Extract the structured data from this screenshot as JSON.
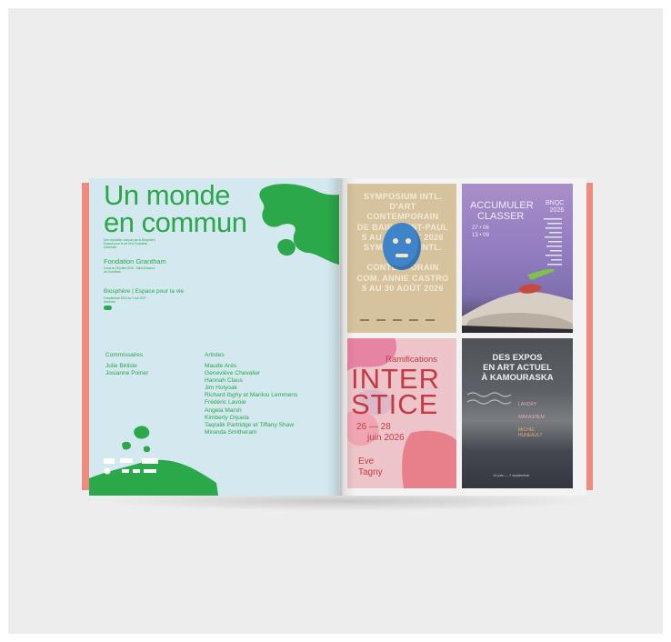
{
  "colors": {
    "background": "#ededed",
    "left_page": "#d3e8ef",
    "green_accent": "#2aa84a",
    "cover_edge": "#f08a7e",
    "poster1_bg": "#d6c39e",
    "poster3_bg": "#ecc4c9",
    "poster3_text": "#c43a43",
    "mask_blue": "#3f83c9"
  },
  "left_page": {
    "title_line1": "Un monde",
    "title_line2": "en commun",
    "intro": "Une exposition conçue par la Biosphère, Espace pour la vie et la Fondation Grantham",
    "venue1_name": "Fondation Grantham",
    "venue1_detail": "3 mai au 26 juillet 2026 · Saint-Edmond-de-Grantham",
    "venue2_name": "Biosphère | Espace pour la vie",
    "venue2_detail": "9 septembre 2026 au 2 mai 2027 · Montréal",
    "commissaires_heading": "Commissaires",
    "commissaires": [
      "Julie Bélisle",
      "Josianne Poirier"
    ],
    "artistes_heading": "Artistes",
    "artistes": [
      "Maude Arès",
      "Geneviève Chevalier",
      "Hannah Claus",
      "Jim Holyoak",
      "Richard Ibghy et Marilou Lemmens",
      "Frédéric Lavoie",
      "Angela Marsh",
      "Kimberly Orjuela",
      "Taqralik Partridge et Tiffany Shaw",
      "Miranda Smitheram"
    ]
  },
  "posters": {
    "p1_lines": [
      "SYMPOSIUM INTL.",
      "D'ART CONTEMPORAIN",
      "DE BAIE-SAINT-PAUL",
      "5 AU 30 AOÛT 2026",
      "SYMPOSIUM INTL.",
      "D'ART CONTEMPORAIN",
      "COM. ANNIE CASTRO",
      "5 AU 30 AOÛT 2026"
    ],
    "p2_title1": "ACCUMULER",
    "p2_title2": "CLASSER",
    "p2_tag1": "BNQC",
    "p2_tag2": "2026",
    "p2_date1": "27 • 06",
    "p2_date2": "13 • 09",
    "p3_top": "Ramifications",
    "p3_big1": "INTER",
    "p3_big2": "STICE",
    "p3_date1": "26 — 28",
    "p3_date2": "juin 2026",
    "p3_name1": "Eve",
    "p3_name2": "Tagny",
    "p4_title1": "DES EXPOS",
    "p4_title2": "EN ART ACTUEL",
    "p4_title3": "À KAMOURASKA",
    "p4_names": [
      "LANDRY",
      "MAKASHEM",
      "MICHEL",
      "HUNEAULT"
    ],
    "p4_foot": "14 juin — 7 septembre"
  }
}
